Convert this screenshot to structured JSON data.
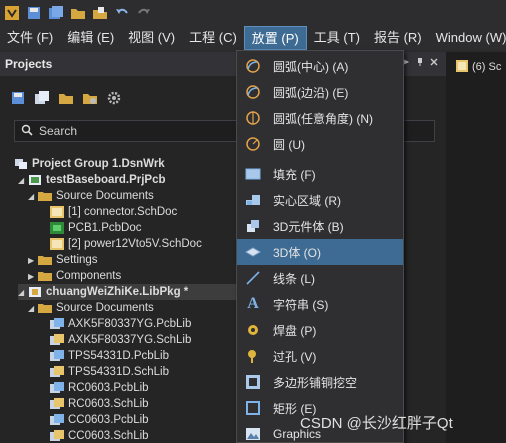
{
  "menubar": {
    "items": [
      "文件 (F)",
      "编辑 (E)",
      "视图 (V)",
      "工程 (C)",
      "放置 (P)",
      "工具 (T)",
      "报告 (R)",
      "Window (W)"
    ],
    "active_index": 4
  },
  "panel": {
    "title": "Projects",
    "search_placeholder": "Search"
  },
  "tree": [
    {
      "label": "Project Group 1.DsnWrk",
      "bold": true
    },
    {
      "label": "testBaseboard.PrjPcb",
      "bold": true
    },
    {
      "label": "Source Documents"
    },
    {
      "label": "[1] connector.SchDoc"
    },
    {
      "label": "PCB1.PcbDoc"
    },
    {
      "label": "[2] power12Vto5V.SchDoc"
    },
    {
      "label": "Settings"
    },
    {
      "label": "Components"
    },
    {
      "label": "chuangWeiZhiKe.LibPkg *",
      "bold": true
    },
    {
      "label": "Source Documents"
    },
    {
      "label": "AXK5F80337YG.PcbLib"
    },
    {
      "label": "AXK5F80337YG.SchLib"
    },
    {
      "label": "TPS54331D.PcbLib"
    },
    {
      "label": "TPS54331D.SchLib"
    },
    {
      "label": "RC0603.PcbLib"
    },
    {
      "label": "RC0603.SchLib"
    },
    {
      "label": "CC0603.PcbLib"
    },
    {
      "label": "CC0603.SchLib"
    }
  ],
  "right_tab": {
    "label": "(6) Sc"
  },
  "dropdown": {
    "items": [
      "圆弧(中心) (A)",
      "圆弧(边沿) (E)",
      "圆弧(任意角度) (N)",
      "圆 (U)",
      "填充 (F)",
      "实心区域 (R)",
      "3D元件体 (B)",
      "3D体 (O)",
      "线条 (L)",
      "字符串 (S)",
      "焊盘 (P)",
      "过孔 (V)",
      "多边形铺铜挖空",
      "矩形 (E)",
      "Graphics"
    ],
    "highlight_index": 7
  },
  "watermark": "CSDN @长沙红胖子Qt",
  "colors": {
    "accent": "#3e6b93",
    "folder": "#d6a842",
    "text": "#dcdcdc"
  }
}
